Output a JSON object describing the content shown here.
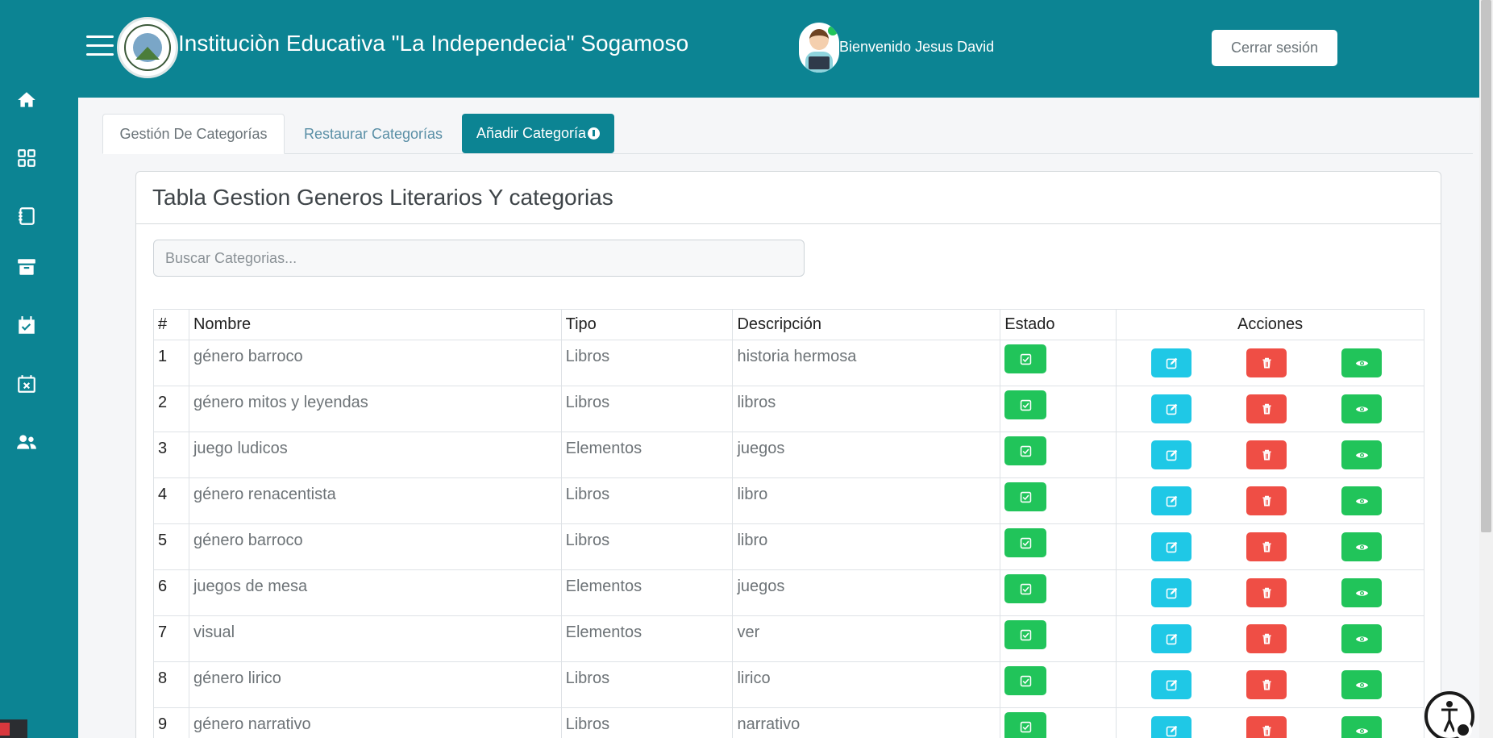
{
  "header": {
    "title": "Instituciòn Educativa \"La Independecia\" Sogamoso",
    "welcome": "Bienvenido Jesus David",
    "logout_label": "Cerrar sesión"
  },
  "sidebar": {
    "items": [
      {
        "icon": "home-icon"
      },
      {
        "icon": "grid-icon"
      },
      {
        "icon": "book-icon"
      },
      {
        "icon": "archive-icon"
      },
      {
        "icon": "calendar-check-icon"
      },
      {
        "icon": "calendar-x-icon"
      },
      {
        "icon": "users-icon"
      }
    ]
  },
  "tabs": [
    {
      "label": "Gestión De Categorías"
    },
    {
      "label": "Restaurar Categorías"
    },
    {
      "label": "Añadir Categoría"
    }
  ],
  "card": {
    "title": "Tabla Gestion Generos Literarios Y categorias",
    "search_placeholder": "Buscar Categorias..."
  },
  "table": {
    "headers": {
      "num": "#",
      "name": "Nombre",
      "tipo": "Tipo",
      "desc": "Descripción",
      "estado": "Estado",
      "acciones": "Acciones"
    },
    "rows": [
      {
        "num": "1",
        "name": "género barroco",
        "tipo": "Libros",
        "desc": "historia hermosa"
      },
      {
        "num": "2",
        "name": "género mitos y leyendas",
        "tipo": "Libros",
        "desc": "libros"
      },
      {
        "num": "3",
        "name": "juego ludicos",
        "tipo": "Elementos",
        "desc": "juegos"
      },
      {
        "num": "4",
        "name": "género renacentista",
        "tipo": "Libros",
        "desc": "libro"
      },
      {
        "num": "5",
        "name": "género barroco",
        "tipo": "Libros",
        "desc": "libro"
      },
      {
        "num": "6",
        "name": "juegos de mesa",
        "tipo": "Elementos",
        "desc": "juegos"
      },
      {
        "num": "7",
        "name": "visual",
        "tipo": "Elementos",
        "desc": "ver"
      },
      {
        "num": "8",
        "name": "género lirico",
        "tipo": "Libros",
        "desc": "lirico"
      },
      {
        "num": "9",
        "name": "género narrativo",
        "tipo": "Libros",
        "desc": "narrativo"
      }
    ]
  },
  "colors": {
    "brand": "#0c8493",
    "state_green": "#21c45a",
    "edit_cyan": "#1fc8e6",
    "delete_red": "#ef4e45"
  }
}
